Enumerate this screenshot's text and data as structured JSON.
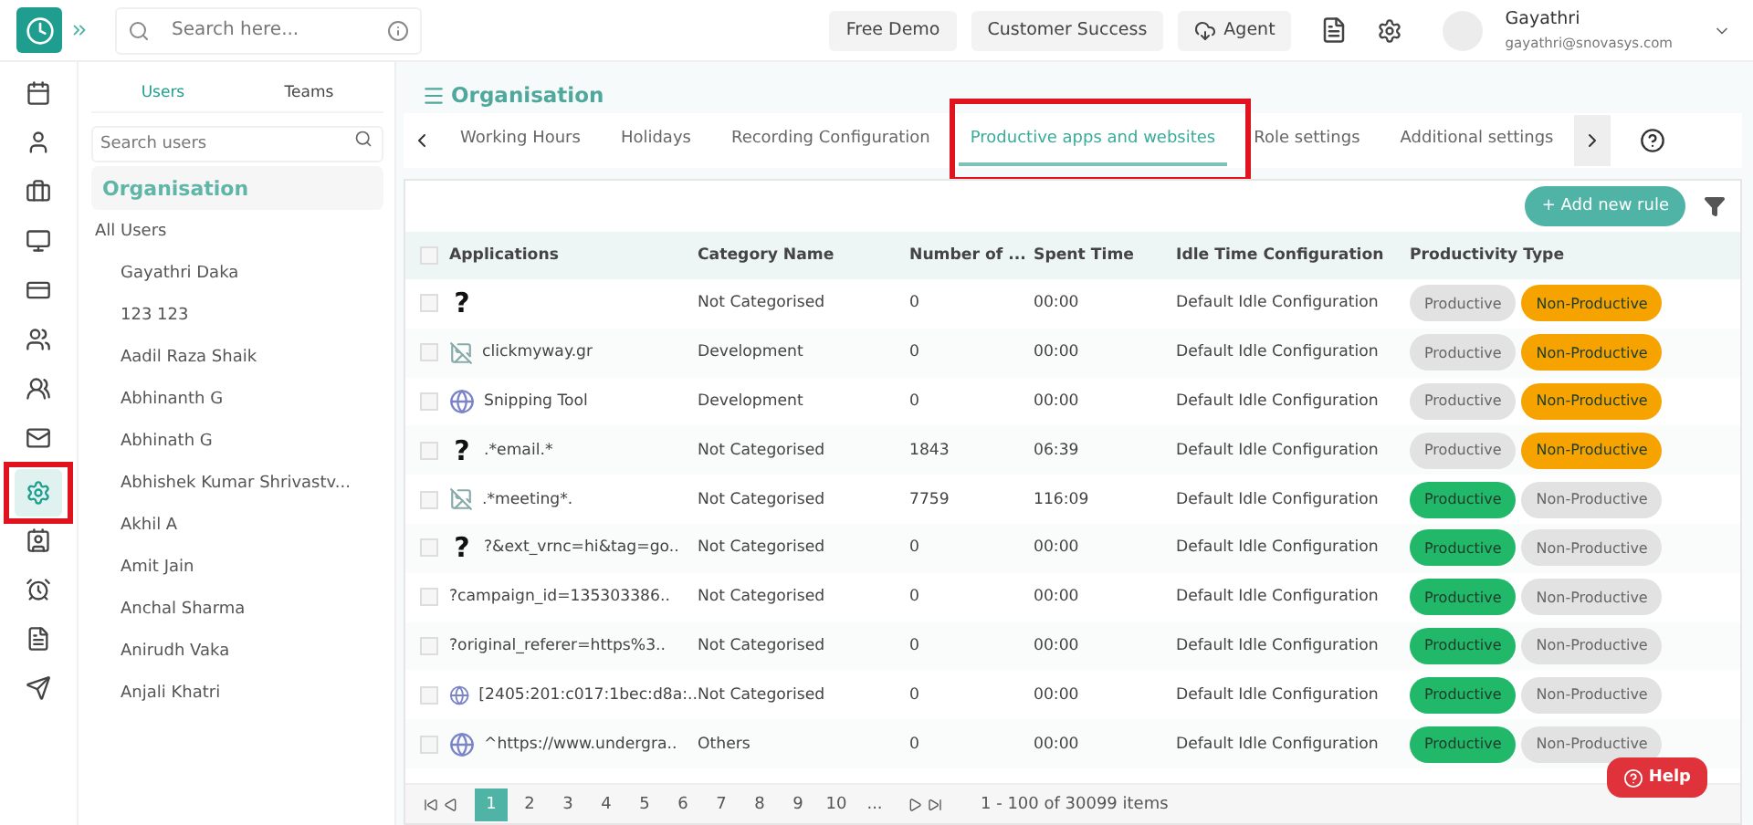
{
  "topbar": {
    "search_placeholder": "Search here...",
    "buttons": [
      "Free Demo",
      "Customer Success",
      "Agent"
    ],
    "user": {
      "name": "Gayathri",
      "email": "gayathri@snovasys.com"
    }
  },
  "rail": {
    "items": [
      {
        "selected": false,
        "highlighted": false
      },
      {
        "selected": false,
        "highlighted": false
      },
      {
        "selected": false,
        "highlighted": false
      },
      {
        "selected": false,
        "highlighted": false
      },
      {
        "selected": false,
        "highlighted": false
      },
      {
        "selected": false,
        "highlighted": false
      },
      {
        "selected": false,
        "highlighted": false
      },
      {
        "selected": false,
        "highlighted": false
      },
      {
        "selected": true,
        "highlighted": true
      },
      {
        "selected": false,
        "highlighted": false
      },
      {
        "selected": false,
        "highlighted": false
      },
      {
        "selected": false,
        "highlighted": false
      },
      {
        "selected": false,
        "highlighted": false
      }
    ]
  },
  "people_panel": {
    "tabs": [
      {
        "label": "Users",
        "selected": true
      },
      {
        "label": "Teams",
        "selected": false
      }
    ],
    "search_placeholder": "Search users",
    "group": "Organisation",
    "all_label": "All Users",
    "users": [
      "Gayathri Daka",
      "123 123",
      "Aadil Raza Shaik",
      "Abhinanth G",
      "Abhinath G",
      "Abhishek Kumar Shrivastv...",
      "Akhil A",
      "Amit Jain",
      "Anchal Sharma",
      "Anirudh Vaka",
      "Anjali Khatri"
    ]
  },
  "main": {
    "title": "Organisation",
    "tabs": [
      {
        "label": "Working Hours",
        "selected": false,
        "highlighted": false
      },
      {
        "label": "Holidays",
        "selected": false,
        "highlighted": false
      },
      {
        "label": "Recording Configuration",
        "selected": false,
        "highlighted": false
      },
      {
        "label": "Productive apps and websites",
        "selected": true,
        "highlighted": true
      },
      {
        "label": "Role settings",
        "selected": false,
        "highlighted": false
      },
      {
        "label": "Additional settings",
        "selected": false,
        "highlighted": false
      }
    ],
    "add_button": "+ Add new rule"
  },
  "table": {
    "all_checked": false,
    "columns": [
      "Applications",
      "Category Name",
      "Number of ...",
      "Spent Time",
      "Idle Time Configuration",
      "Productivity Type"
    ],
    "rows": [
      {
        "checked": false,
        "kind": "symbol",
        "symbol": "?",
        "application": "",
        "category": "Not Categorised",
        "number": "0",
        "spent": "00:00",
        "idle": "Default Idle Configuration",
        "productive": false,
        "labels": [
          "Productive",
          "Non-Productive"
        ]
      },
      {
        "checked": false,
        "kind": "image",
        "application": "clickmyway.gr",
        "category": "Development",
        "number": "0",
        "spent": "00:00",
        "idle": "Default Idle Configuration",
        "productive": false,
        "labels": [
          "Productive",
          "Non-Productive"
        ]
      },
      {
        "checked": false,
        "kind": "globe",
        "application": "Snipping Tool",
        "category": "Development",
        "number": "0",
        "spent": "00:00",
        "idle": "Default Idle Configuration",
        "productive": false,
        "labels": [
          "Productive",
          "Non-Productive"
        ]
      },
      {
        "checked": false,
        "kind": "symbol",
        "symbol": "?",
        "application": ".*email.*",
        "category": "Not Categorised",
        "number": "1843",
        "spent": "06:39",
        "idle": "Default Idle Configuration",
        "productive": false,
        "labels": [
          "Productive",
          "Non-Productive"
        ]
      },
      {
        "checked": false,
        "kind": "image",
        "application": ".*meeting*.",
        "category": "Not Categorised",
        "number": "7759",
        "spent": "116:09",
        "idle": "Default Idle Configuration",
        "productive": true,
        "labels": [
          "Productive",
          "Non-Productive"
        ]
      },
      {
        "checked": false,
        "kind": "symbol",
        "symbol": "?",
        "application": "?&ext_vrnc=hi&tag=go..",
        "category": "Not Categorised",
        "number": "0",
        "spent": "00:00",
        "idle": "Default Idle Configuration",
        "productive": true,
        "labels": [
          "Productive",
          "Non-Productive"
        ]
      },
      {
        "checked": false,
        "kind": "plain",
        "application": "?campaign_id=135303386..",
        "category": "Not Categorised",
        "number": "0",
        "spent": "00:00",
        "idle": "Default Idle Configuration",
        "productive": true,
        "labels": [
          "Productive",
          "Non-Productive"
        ]
      },
      {
        "checked": false,
        "kind": "plain",
        "application": "?original_referer=https%3..",
        "category": "Not Categorised",
        "number": "0",
        "spent": "00:00",
        "idle": "Default Idle Configuration",
        "productive": true,
        "labels": [
          "Productive",
          "Non-Productive"
        ]
      },
      {
        "checked": false,
        "kind": "globe",
        "application": "[2405:201:c017:1bec:d8a:..",
        "category": "Not Categorised",
        "number": "0",
        "spent": "00:00",
        "idle": "Default Idle Configuration",
        "productive": true,
        "labels": [
          "Productive",
          "Non-Productive"
        ]
      },
      {
        "checked": false,
        "kind": "globe",
        "application": "^https://www.undergra..",
        "category": "Others",
        "number": "0",
        "spent": "00:00",
        "idle": "Default Idle Configuration",
        "productive": true,
        "labels": [
          "Productive",
          "Non-Productive"
        ]
      }
    ]
  },
  "pager": {
    "pages": [
      {
        "label": "1",
        "selected": true
      },
      {
        "label": "2",
        "selected": false
      },
      {
        "label": "3",
        "selected": false
      },
      {
        "label": "4",
        "selected": false
      },
      {
        "label": "5",
        "selected": false
      },
      {
        "label": "6",
        "selected": false
      },
      {
        "label": "7",
        "selected": false
      },
      {
        "label": "8",
        "selected": false
      },
      {
        "label": "9",
        "selected": false
      },
      {
        "label": "10",
        "selected": false
      },
      {
        "label": "...",
        "selected": false
      }
    ],
    "summary": "1 - 100 of 30099 items"
  },
  "help": "Help"
}
